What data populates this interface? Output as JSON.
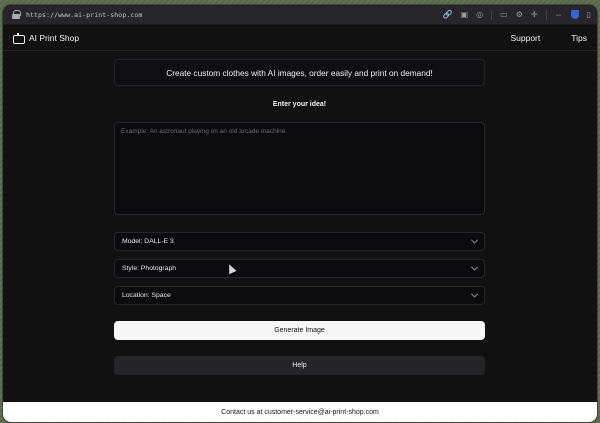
{
  "browser": {
    "url": "https://www.ai-print-shop.com"
  },
  "nav": {
    "brand": "AI Print Shop",
    "links": [
      "Support",
      "Tips"
    ]
  },
  "main": {
    "banner": "Create custom clothes with AI images, order easily and print on demand!",
    "prompt_label": "Enter your idea!",
    "prompt_placeholder": "Example: An astronaut playing on an old arcade machine.",
    "prompt_value": "",
    "selects": [
      {
        "label": "Model: DALL-E 3"
      },
      {
        "label": "Style: Photograph"
      },
      {
        "label": "Location: Space"
      }
    ],
    "generate_label": "Generate Image",
    "help_label": "Help"
  },
  "footer": {
    "contact": "Contact us at customer-service@ai-print-shop.com"
  },
  "icons": {
    "lock": "lock-icon",
    "brand": "robot-icon",
    "chevron": "chevron-down-icon"
  },
  "colors": {
    "background": "#111112",
    "panel": "#0b0b0d",
    "primary_button": "#f7f7f8",
    "secondary_button": "#252528",
    "accent_shield": "#3c62d8"
  }
}
